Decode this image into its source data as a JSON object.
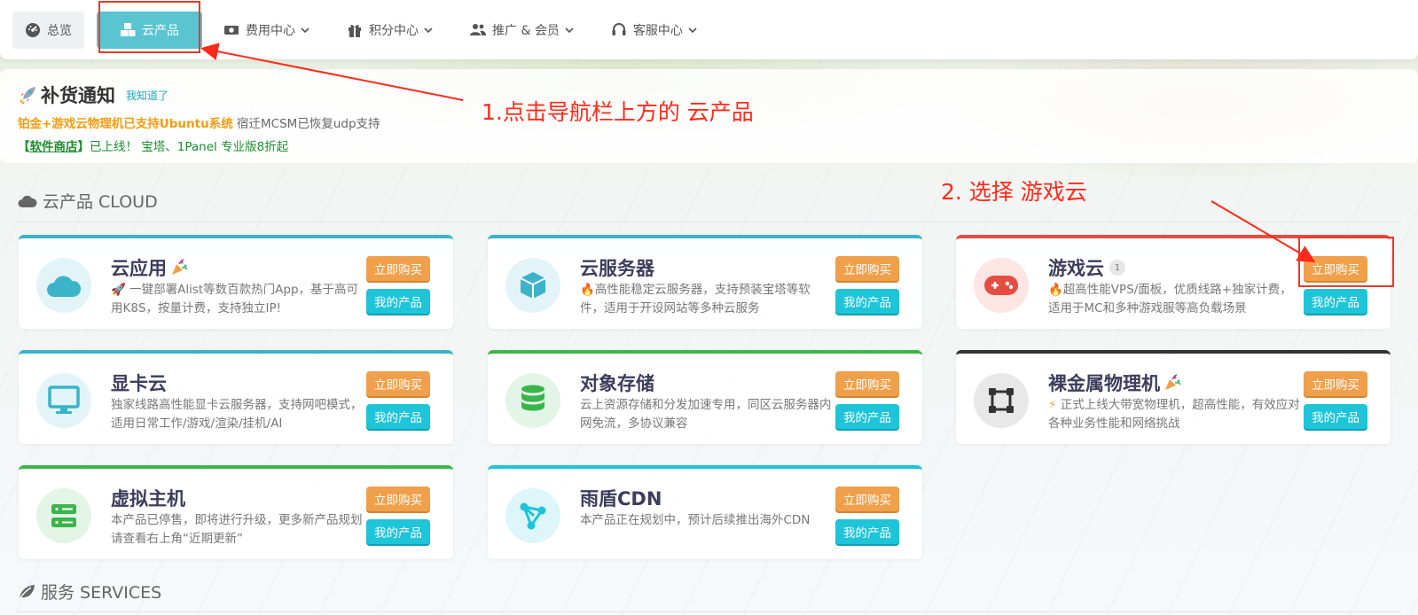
{
  "nav": {
    "items": [
      {
        "label": "总览",
        "icon": "dashboard-icon"
      },
      {
        "label": "云产品",
        "icon": "cubes-icon",
        "active": true
      },
      {
        "label": "费用中心",
        "icon": "money-icon"
      },
      {
        "label": "积分中心",
        "icon": "gift-icon"
      },
      {
        "label": "推广 & 会员",
        "icon": "users-icon"
      },
      {
        "label": "客服中心",
        "icon": "headset-icon"
      }
    ]
  },
  "notice": {
    "title": "补货通知",
    "dismiss": "我知道了",
    "line1_highlight": "铂金+游戏云物理机已支持Ubuntu系统",
    "line1_rest": "宿迁MCSM已恢复udp支持",
    "line2_bracket_open": "【",
    "line2_link": "软件商店",
    "line2_bracket_close": "】",
    "line2_rest": "已上线！  宝塔、1Panel 专业版8折起"
  },
  "annotations": {
    "step1": "1.点击导航栏上方的  云产品",
    "step2": "2. 选择  游戏云"
  },
  "section_cloud": {
    "title": "云产品 CLOUD"
  },
  "section_services": {
    "title": "服务 SERVICES"
  },
  "buttons": {
    "buy": "立即购买",
    "mine": "我的产品"
  },
  "cards": [
    {
      "title": "云应用",
      "desc": "一键部署Alist等数百款热门App，基于高可用K8S，按量计费，支持独立IP!",
      "accent": "#3bb3c9"
    },
    {
      "title": "云服务器",
      "desc": "高性能稳定云服务器，支持预装宝塔等软件，适用于开设网站等多种云服务",
      "accent": "#3bb3c9"
    },
    {
      "title": "游戏云",
      "badge": "1",
      "desc": "超高性能VPS/面板，优质线路+独家计费，适用于MC和多种游戏服等高负载场景",
      "accent": "#e54d42"
    },
    {
      "title": "显卡云",
      "desc": "独家线路高性能显卡云服务器，支持网吧模式，适用日常工作/游戏/渲染/挂机/AI",
      "accent": "#3bb3c9"
    },
    {
      "title": "对象存储",
      "desc": "云上资源存储和分发加速专用，同区云服务器内网免流，多协议兼容",
      "accent": "#39b54a"
    },
    {
      "title": "裸金属物理机",
      "desc": "正式上线大带宽物理机，超高性能，有效应对各种业务性能和网络挑战",
      "accent": "#333333"
    },
    {
      "title": "虚拟主机",
      "desc": "本产品已停售，即将进行升级，更多新产品规划请查看右上角“近期更新”",
      "accent": "#39b54a"
    },
    {
      "title": "雨盾CDN",
      "desc": "本产品正在规划中，预计后续推出海外CDN",
      "accent": "#1ec4d8"
    }
  ]
}
